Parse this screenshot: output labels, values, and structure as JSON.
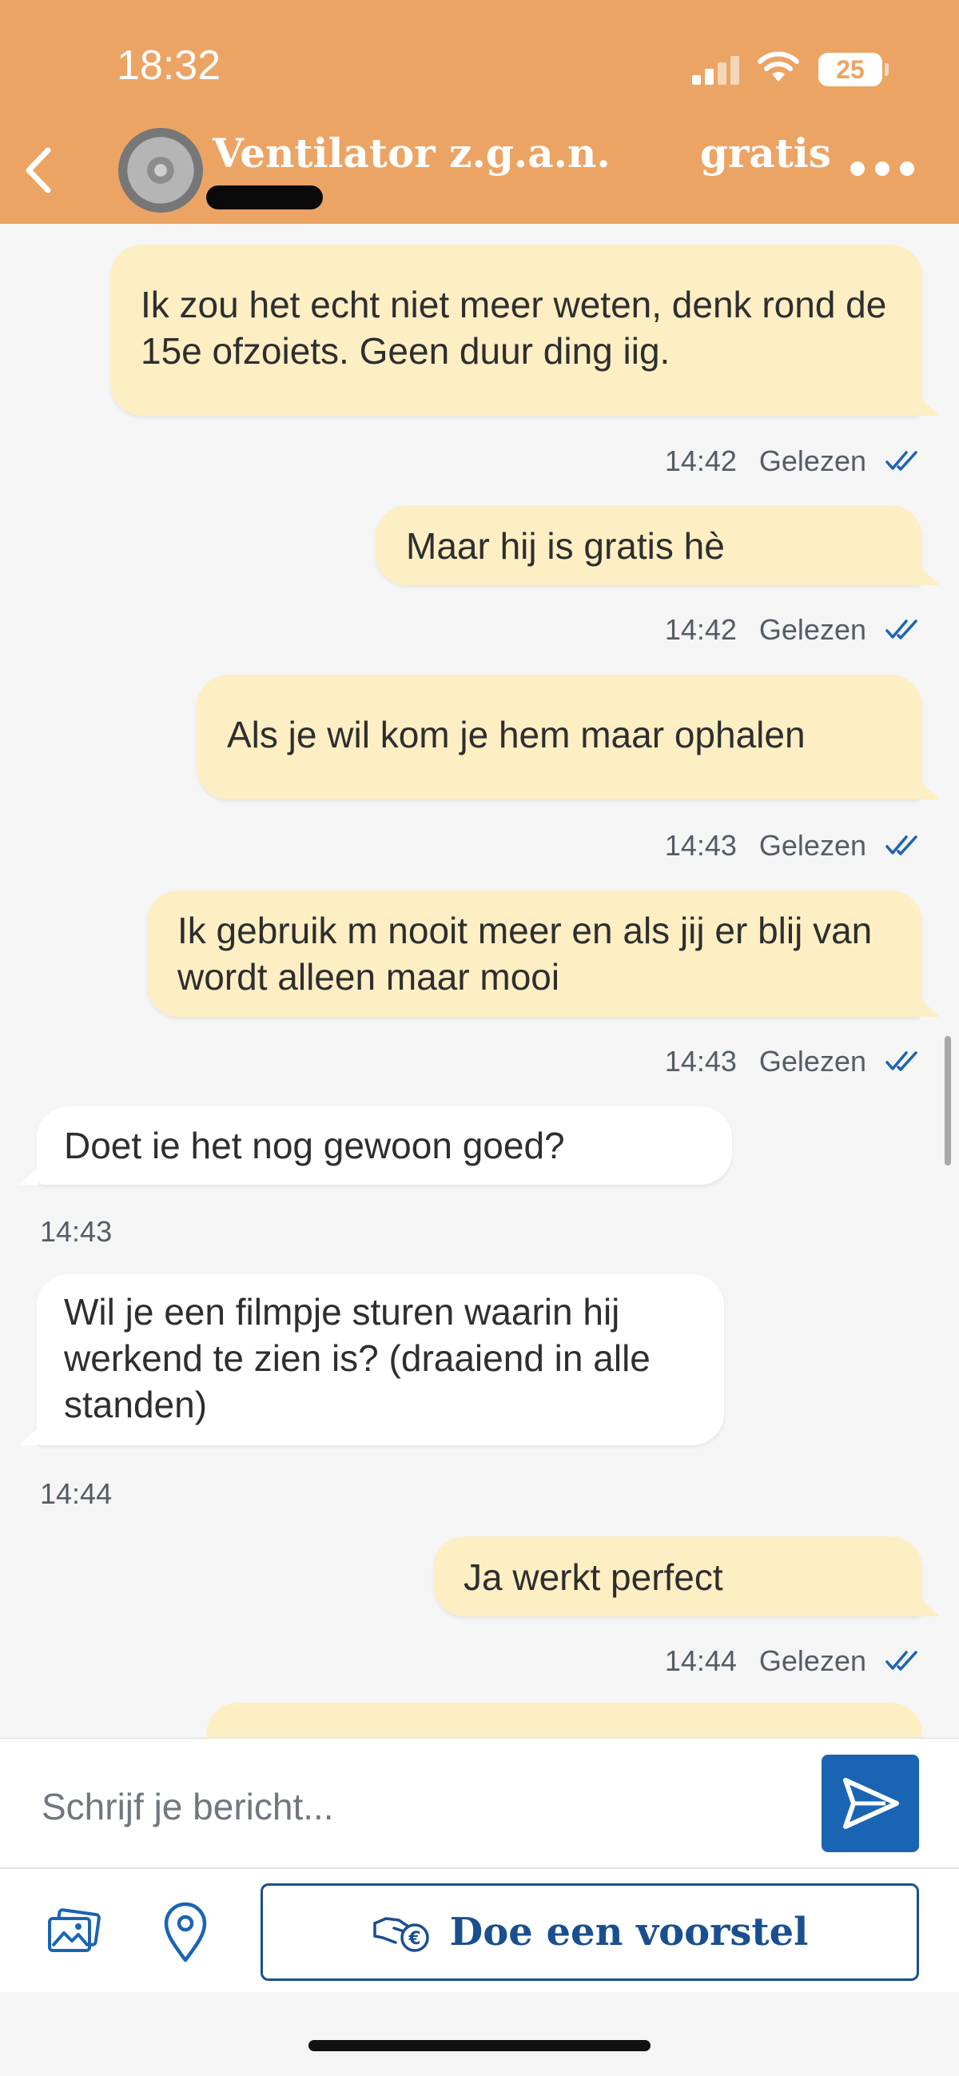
{
  "status_bar": {
    "time": "18:32",
    "battery": "25"
  },
  "header": {
    "title": "Ventilator z.g.a.n.",
    "price": "gratis"
  },
  "messages": [
    {
      "direction": "out",
      "text": "Ik zou het echt niet meer weten, denk rond de 15e ofzoiets. Geen duur ding iig.",
      "time": "14:42",
      "status": "Gelezen"
    },
    {
      "direction": "out",
      "text": "Maar hij is gratis hè",
      "time": "14:42",
      "status": "Gelezen"
    },
    {
      "direction": "out",
      "text": "Als je wil kom je hem maar ophalen",
      "time": "14:43",
      "status": "Gelezen"
    },
    {
      "direction": "out",
      "text": "Ik gebruik m nooit meer en als jij er blij van wordt alleen maar mooi",
      "time": "14:43",
      "status": "Gelezen"
    },
    {
      "direction": "in",
      "text": "Doet ie het nog gewoon goed?",
      "time": "14:43"
    },
    {
      "direction": "in",
      "text": "Wil je een filmpje sturen waarin hij werkend te zien is? (draaiend in alle standen)",
      "time": "14:44"
    },
    {
      "direction": "out",
      "text": "Ja werkt perfect",
      "time": "14:44",
      "status": "Gelezen"
    }
  ],
  "composer": {
    "placeholder": "Schrijf je bericht..."
  },
  "actions": {
    "offer_label": "Doe een voorstel"
  },
  "colors": {
    "header": "#eca464",
    "outgoing_bubble": "#fdeec4",
    "incoming_bubble": "#ffffff",
    "brand_blue": "#1a64b4"
  },
  "icons": [
    "chevron-left-icon",
    "more-icon",
    "double-check-icon",
    "send-icon",
    "photos-icon",
    "location-pin-icon",
    "offer-hand-icon"
  ]
}
